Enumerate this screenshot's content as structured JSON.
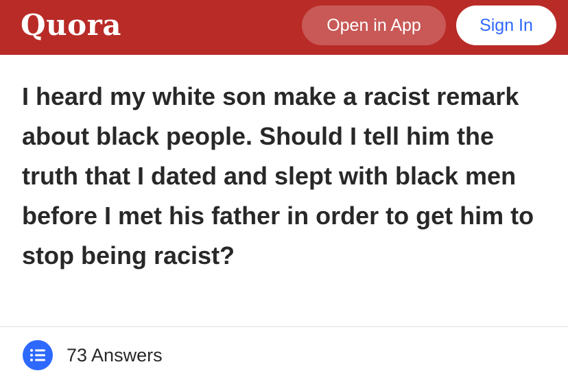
{
  "header": {
    "logo": "Quora",
    "open_in_app": "Open in App",
    "sign_in": "Sign In",
    "brand_color": "#b92b27",
    "link_color": "#2e69ff"
  },
  "question": {
    "text": "I heard my white son make a racist remark about black people. Should I tell him the truth that I dated and slept with black men before I met his father in order to get him to stop being racist?"
  },
  "answers": {
    "icon": "list-icon",
    "label": "73 Answers"
  }
}
